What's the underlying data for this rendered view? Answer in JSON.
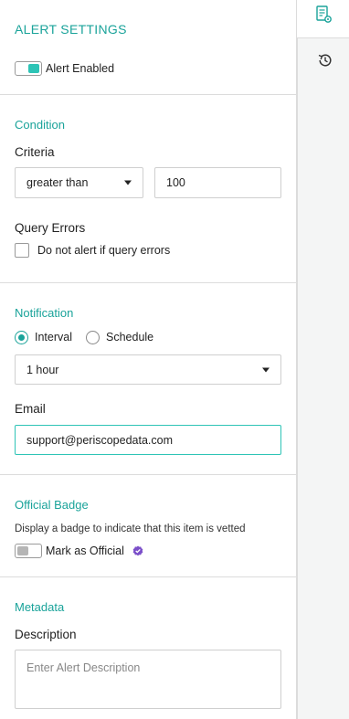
{
  "header": {
    "title": "ALERT SETTINGS",
    "alert_toggle": {
      "label": "Alert Enabled",
      "on": true
    }
  },
  "condition": {
    "title": "Condition",
    "criteria_label": "Criteria",
    "operator_value": "greater than",
    "threshold_value": "100",
    "query_errors_label": "Query Errors",
    "query_errors_checkbox": {
      "label": "Do not alert if query errors",
      "checked": false
    }
  },
  "notification": {
    "title": "Notification",
    "options": [
      {
        "label": "Interval",
        "selected": true
      },
      {
        "label": "Schedule",
        "selected": false
      }
    ],
    "interval_value": "1 hour",
    "email_label": "Email",
    "email_value": "support@periscopedata.com"
  },
  "badge": {
    "title": "Official Badge",
    "help": "Display a badge to indicate that this item is vetted",
    "toggle": {
      "label": "Mark as Official",
      "on": false
    }
  },
  "metadata": {
    "title": "Metadata",
    "description_label": "Description",
    "description_placeholder": "Enter Alert Description"
  },
  "colors": {
    "accent": "#1aa39a",
    "toggle_on": "#2ec4b6",
    "verified": "#7b4fc9"
  },
  "rail": {
    "icons": [
      "alert-settings-icon",
      "history-icon"
    ]
  }
}
